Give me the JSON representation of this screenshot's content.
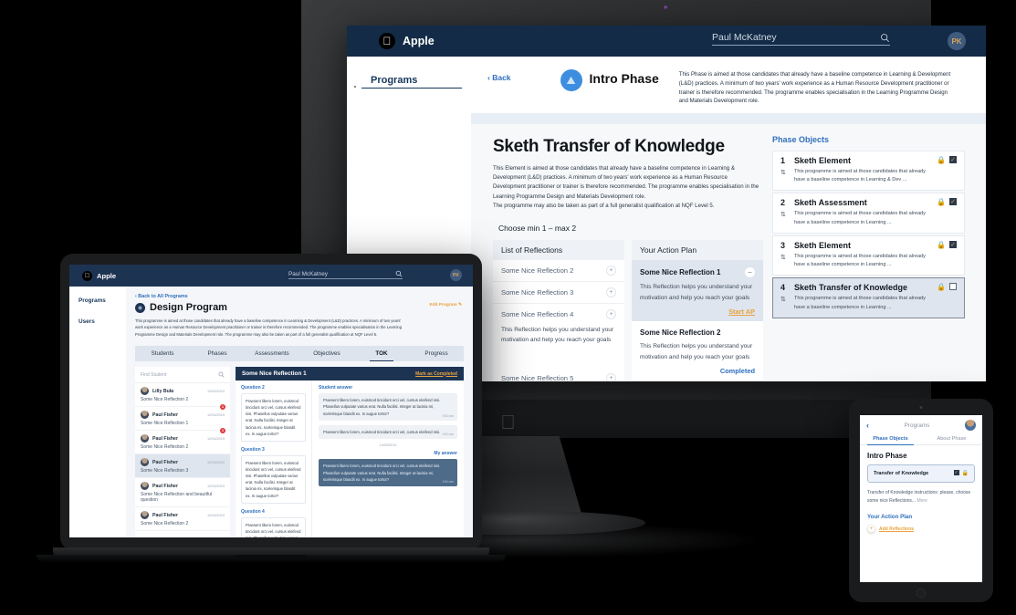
{
  "desktop": {
    "topbar": {
      "brand": "Apple",
      "apple_icon": "apple-logo-icon",
      "search_value": "Paul McKatney",
      "search_icon": "search-icon",
      "avatar_initials": "PK"
    },
    "sidebar": {
      "items": [
        {
          "label": "Programs"
        }
      ]
    },
    "phase_bar": {
      "back_label": "Back",
      "phase_icon": "phase-badge-icon",
      "phase_title": "Intro Phase",
      "phase_description": "This Phase is aimed at those candidates that already have a baseline competence in Learning & Development (L&D) practices. A minimum of two years' work experience as a Human Resource Development practitioner or trainer is therefore recommended. The programme enables specialisation in the Learning Programme Design and Materials Development role."
    },
    "element": {
      "title": "Sketh Transfer of Knowledge",
      "description_1": "This Element is aimed at those candidates that already have a baseline competence in Learning & Development (L&D) practices. A minimum of two years' work experience as a Human Resource Development practitioner or trainer is therefore recommended. The programme enables specialisation in the Learning Programme Design and Materials Development role.",
      "description_2": "The programme may also be taken as part of a full generalist qualification at NQF Level 5.",
      "choose_hint": "Choose min 1 – max 2"
    },
    "reflections_column": {
      "header": "List of Reflections",
      "add_icon": "plus-icon",
      "items": [
        {
          "title": "Some Nice Reflection 2",
          "body": ""
        },
        {
          "title": "Some Nice Reflection 3",
          "body": ""
        },
        {
          "title": "Some Nice Reflection 4",
          "body": "This Reflection helps you understand your motivation and help you reach your goals"
        },
        {
          "title": "Some Nice Reflection 5",
          "body": ""
        }
      ]
    },
    "action_plan_column": {
      "header": "Your Action Plan",
      "remove_icon": "minus-icon",
      "items": [
        {
          "title": "Some Nice Reflection 1",
          "body": "This Reflection helps you understand your motivation and help you reach your goals",
          "link": "Start AP",
          "state": "selected"
        },
        {
          "title": "Some Nice Reflection 2",
          "body": "This Reflection helps you understand your motivation and help you reach your goals",
          "link": "Completed",
          "state": "plain"
        }
      ]
    },
    "phase_objects": {
      "header": "Phase Objects",
      "lock_icon": "lock-icon",
      "sort_icon": "sort-updown-icon",
      "items": [
        {
          "num": "1",
          "title": "Sketh Element",
          "desc": "This programme is aimed at those candidates that already have a baseline competence in Learning & Dev ...",
          "checked": true,
          "selected": false
        },
        {
          "num": "2",
          "title": "Sketh Assessment",
          "desc": "This programme is aimed at those candidates that already have a baseline competence in Learning ...",
          "checked": true,
          "selected": false
        },
        {
          "num": "3",
          "title": "Sketh Element",
          "desc": "This programme is aimed at those candidates that already have a baseline competence in Learning ...",
          "checked": true,
          "selected": false
        },
        {
          "num": "4",
          "title": "Sketh Transfer of Knowledge",
          "desc": "This programme is aimed at those candidates that already have a baseline competence in Learning ...",
          "checked": false,
          "selected": true
        }
      ]
    }
  },
  "laptop": {
    "topbar": {
      "brand": "Apple",
      "search_value": "Paul McKatney",
      "avatar_initials": "PK"
    },
    "sidebar": {
      "items": [
        {
          "label": "Programs"
        },
        {
          "label": "Users"
        }
      ]
    },
    "header": {
      "breadcrumb": "Back to All Programs",
      "title": "Design Program",
      "edit_label": "Edit Program",
      "edit_icon": "pencil-icon",
      "description": "This programme is aimed at those candidates that already have a baseline competence in Learning & Development (L&D) practices. A minimum of two years' work experience as a Human Resource Development practitioner or trainer is therefore recommended. The programme enables specialisation in the Learning Programme Design and Materials Development role. The programme may also be taken as part of a full generalist qualification at NQF Level 5."
    },
    "tabs": [
      {
        "label": "Students",
        "active": false
      },
      {
        "label": "Phases",
        "active": false
      },
      {
        "label": "Assessments",
        "active": false
      },
      {
        "label": "Objectives",
        "active": false
      },
      {
        "label": "TOK",
        "active": true
      },
      {
        "label": "Progress",
        "active": false
      }
    ],
    "students": {
      "search_placeholder": "Find Student",
      "search_icon": "search-icon",
      "rows": [
        {
          "name": "Lilly Bula",
          "date": "12/03/2019",
          "sub": "Some Nice Reflection 2",
          "badge": "1",
          "selected": false
        },
        {
          "name": "Paul Fisher",
          "date": "12/03/2019",
          "sub": "Some Nice Reflection 1",
          "badge": "1",
          "selected": false
        },
        {
          "name": "Paul Fisher",
          "date": "12/03/2019",
          "sub": "Some Nice Reflection 2",
          "badge": "",
          "selected": false
        },
        {
          "name": "Paul Fisher",
          "date": "12/03/2019",
          "sub": "Some Nice Reflection 3",
          "badge": "",
          "selected": true
        },
        {
          "name": "Paul Fisher",
          "date": "12/03/2019",
          "sub": "Some Nice Reflection and beautiful question",
          "badge": "",
          "selected": false
        },
        {
          "name": "Paul Fisher",
          "date": "12/03/2019",
          "sub": "Some Nice Reflection 2",
          "badge": "",
          "selected": false
        }
      ]
    },
    "chat": {
      "title": "Some Nice Reflection 1",
      "action": "Mark as Completed",
      "questions_label_2": "Question 2",
      "questions_label_3": "Question 3",
      "questions_label_4": "Question 4",
      "question_text": "Praesent libero lorem, euismod tincidunt orci vel, cursus eleifend nisi. Phasellus vulputate varius erat. Nulla facilisi. Integer at lacinia mi, scelerisque blandit ex. In augue tortor?",
      "student_answer_label": "Student answer",
      "answer_1": "Praesent libero lorem, euismod tincidunt orci vel, cursus eleifend nisi. Phasellus vulputate varius erat. Nulla facilisi. Integer at lacinia mi, scelerisque blandit ex. In augue tortor?",
      "answer_1_time": "9:40 am",
      "answer_2": "Praesent libero lorem, euismod tincidunt orci vel, cursus eleifend nisi.",
      "answer_2_time": "9:40 am",
      "date_separator": "13/03/2019",
      "my_answer_label": "My answer",
      "my_answer": "Praesent libero lorem, euismod tincidunt orci vel, cursus eleifend nisi. Phasellus vulputate varius erat. Nulla facilisi. Integer at lacinia mi, scelerisque blandit ex. In augue tortor?",
      "my_answer_time": "9:40 am"
    }
  },
  "tablet": {
    "nav": {
      "back_icon": "chevron-left-icon",
      "title": "Programs",
      "avatar": "user-avatar"
    },
    "tabs": [
      {
        "label": "Phase Objects",
        "active": true
      },
      {
        "label": "About Phase",
        "active": false
      }
    ],
    "heading": "Intro Phase",
    "card": {
      "title": "Transfer of Knowledge",
      "checkbox_icon": "checkbox-checked-icon",
      "lock_icon": "lock-icon"
    },
    "note": "Transfer of Knowledge instructions: please, choose some nice Reflections...",
    "note_more": "More",
    "action_plan_label": "Your Action Plan",
    "add_label": "Add Reflections",
    "add_icon": "plus-icon"
  },
  "colors": {
    "navy": "#132b47",
    "accent_orange": "#e8a33d",
    "link_blue": "#2f6fbd",
    "panel_gray": "#eef1f5",
    "selected_gray": "#dfe5ee"
  }
}
